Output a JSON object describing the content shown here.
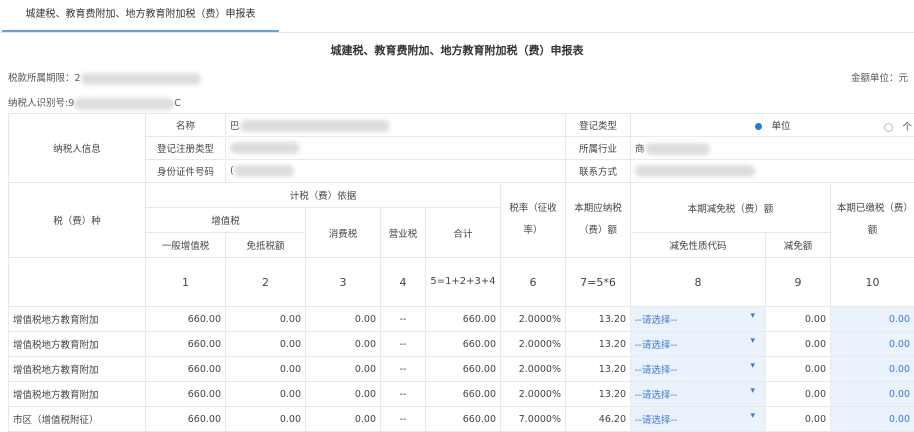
{
  "tab": {
    "label": "城建税、教育费附加、地方教育附加税（费）申报表"
  },
  "title": "城建税、教育费附加、地方教育附加税（费）申报表",
  "meta": {
    "period_label": "税款所属期限：",
    "period_value": "2",
    "taxpayer_id_label": "纳税人识别号:",
    "taxpayer_id_value_start": "9",
    "taxpayer_id_value_end": "C",
    "unit": "金额单位：元"
  },
  "info": {
    "section_label": "纳税人信息",
    "name_label": "名称",
    "name_value": "巴",
    "reg_type_label": "登记注册类型",
    "id_type_label": "身份证件号码",
    "id_value": "(",
    "reg_category_label": "登记类型",
    "reg_category_options": [
      "单位",
      "个"
    ],
    "reg_category_selected": "单位",
    "industry_label": "所属行业",
    "industry_value": "商",
    "contact_label": "联系方式"
  },
  "header": {
    "tax_type": "税（费）种",
    "basis": "计税（费）依据",
    "vat": "增值税",
    "vat_general": "一般增值税",
    "vat_exempt": "免抵税额",
    "consumption": "消费税",
    "business": "营业税",
    "total": "合计",
    "rate": "税率（征收率）",
    "payable": "本期应纳税（费）额",
    "reduction": "本期减免税（费）额",
    "reduction_code": "减免性质代码",
    "reduction_amount": "减免额",
    "paid": "本期已缴税（费）额"
  },
  "col_numbers": [
    "1",
    "2",
    "3",
    "4",
    "5=1+2+3+4",
    "6",
    "7=5*6",
    "8",
    "9",
    "10"
  ],
  "rows": [
    {
      "type": "增值税地方教育附加",
      "c1": "660.00",
      "c2": "0.00",
      "c3": "0.00",
      "c4": "--",
      "c5": "660.00",
      "c6": "2.0000%",
      "c7": "13.20",
      "c8": "--请选择--",
      "c9": "0.00",
      "c10": "0.00"
    },
    {
      "type": "增值税地方教育附加",
      "c1": "660.00",
      "c2": "0.00",
      "c3": "0.00",
      "c4": "--",
      "c5": "660.00",
      "c6": "2.0000%",
      "c7": "13.20",
      "c8": "--请选择--",
      "c9": "0.00",
      "c10": "0.00"
    },
    {
      "type": "增值税地方教育附加",
      "c1": "660.00",
      "c2": "0.00",
      "c3": "0.00",
      "c4": "--",
      "c5": "660.00",
      "c6": "2.0000%",
      "c7": "13.20",
      "c8": "--请选择--",
      "c9": "0.00",
      "c10": "0.00"
    },
    {
      "type": "增值税地方教育附加",
      "c1": "660.00",
      "c2": "0.00",
      "c3": "0.00",
      "c4": "--",
      "c5": "660.00",
      "c6": "2.0000%",
      "c7": "13.20",
      "c8": "--请选择--",
      "c9": "0.00",
      "c10": "0.00"
    },
    {
      "type": "市区（增值税附征）",
      "c1": "660.00",
      "c2": "0.00",
      "c3": "0.00",
      "c4": "--",
      "c5": "660.00",
      "c6": "7.0000%",
      "c7": "46.20",
      "c8": "--请选择--",
      "c9": "0.00",
      "c10": "0.00"
    }
  ],
  "colors": {
    "accent": "#6f9be0",
    "editable_bg": "#eaf2fc",
    "editable_text": "#3a7bd5"
  }
}
